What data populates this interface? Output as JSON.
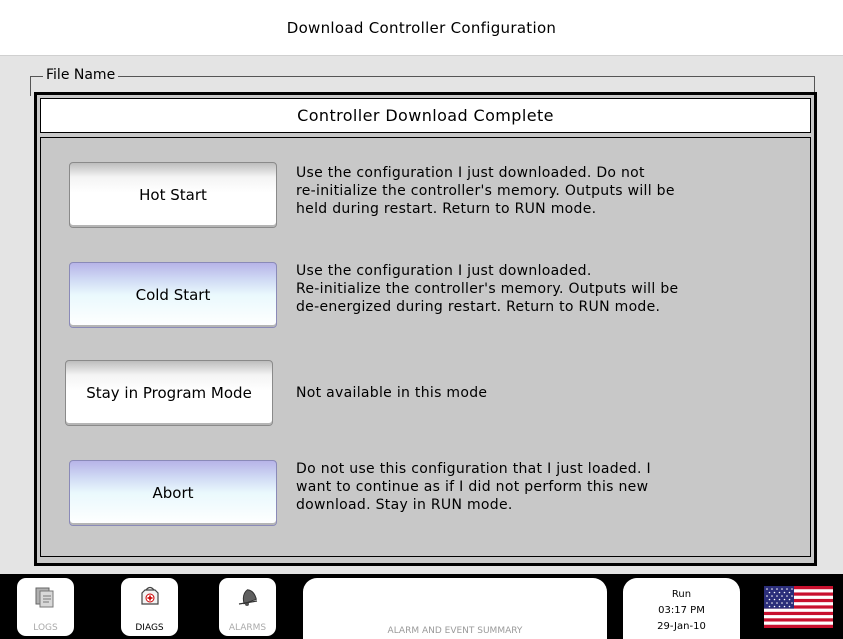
{
  "window": {
    "title": "Download Controller Configuration"
  },
  "file_section": {
    "legend": "File Name"
  },
  "dialog": {
    "title": "Controller Download Complete",
    "options": [
      {
        "label": "Hot Start",
        "style": "white",
        "description": [
          "Use the configuration I just downloaded.  Do not",
          "re-initialize the controller's memory.  Outputs will be",
          "held during restart.  Return to RUN mode."
        ]
      },
      {
        "label": "Cold Start",
        "style": "blue",
        "description": [
          "Use the configuration I just downloaded.",
          "Re-initialize the controller's memory.  Outputs will be",
          "de-energized during restart.  Return to RUN mode."
        ]
      },
      {
        "label": "Stay in Program Mode",
        "style": "white",
        "description": [
          "Not available in this mode"
        ]
      },
      {
        "label": "Abort",
        "style": "blue",
        "description": [
          "Do not use this configuration that I just loaded.  I",
          "want to continue as if I did not perform this new",
          "download.  Stay in RUN mode."
        ]
      }
    ]
  },
  "bottom_bar": {
    "logs": {
      "label": "LOGS",
      "icon": "logs-icon"
    },
    "diags": {
      "label": "DIAGS",
      "icon": "diags-icon"
    },
    "alarms": {
      "label": "ALARMS",
      "icon": "bell-icon"
    },
    "alarm_summary": "ALARM AND EVENT SUMMARY",
    "status": {
      "mode": "Run",
      "time": "03:17 PM",
      "date": "29-Jan-10"
    },
    "flag_icon": "us-flag-icon"
  },
  "colors": {
    "dialog_background": "#c8c8c8",
    "content_background": "#e4e4e4",
    "blue_button_top": "#b7b4e8",
    "bottom_bar": "#000000"
  }
}
